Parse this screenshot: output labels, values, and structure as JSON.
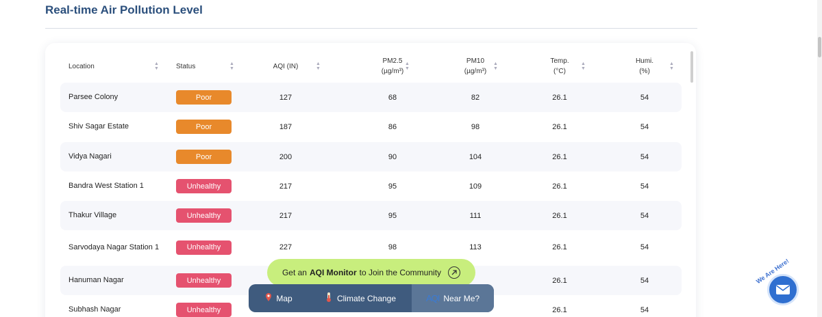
{
  "title": "Real-time Air Pollution Level",
  "table": {
    "headers": [
      {
        "label": "Location",
        "unit": ""
      },
      {
        "label": "Status",
        "unit": ""
      },
      {
        "label": "AQI (IN)",
        "unit": ""
      },
      {
        "label": "PM2.5",
        "unit": "(µg/m³)"
      },
      {
        "label": "PM10",
        "unit": "(µg/m³)"
      },
      {
        "label": "Temp.",
        "unit": "(°C)"
      },
      {
        "label": "Humi.",
        "unit": "(%)"
      }
    ],
    "rows": [
      {
        "location": "Parsee Colony",
        "status": "Poor",
        "aqi": "127",
        "pm25": "68",
        "pm10": "82",
        "temp": "26.1",
        "humi": "54"
      },
      {
        "location": "Shiv Sagar Estate",
        "status": "Poor",
        "aqi": "187",
        "pm25": "86",
        "pm10": "98",
        "temp": "26.1",
        "humi": "54"
      },
      {
        "location": "Vidya Nagari",
        "status": "Poor",
        "aqi": "200",
        "pm25": "90",
        "pm10": "104",
        "temp": "26.1",
        "humi": "54"
      },
      {
        "location": "Bandra West Station 1",
        "status": "Unhealthy",
        "aqi": "217",
        "pm25": "95",
        "pm10": "109",
        "temp": "26.1",
        "humi": "54"
      },
      {
        "location": "Thakur Village",
        "status": "Unhealthy",
        "aqi": "217",
        "pm25": "95",
        "pm10": "111",
        "temp": "26.1",
        "humi": "54"
      },
      {
        "location": "Sarvodaya Nagar Station 1",
        "status": "Unhealthy",
        "aqi": "227",
        "pm25": "98",
        "pm10": "113",
        "temp": "26.1",
        "humi": "54"
      },
      {
        "location": "Hanuman Nagar",
        "status": "Unhealthy",
        "aqi": "",
        "pm25": "",
        "pm10": "",
        "temp": "26.1",
        "humi": "54"
      },
      {
        "location": "Subhash Nagar",
        "status": "Unhealthy",
        "aqi": "",
        "pm25": "",
        "pm10": "",
        "temp": "26.1",
        "humi": "54"
      }
    ]
  },
  "cta": {
    "prefix": "Get an",
    "bold": "AQI Monitor",
    "suffix": "to Join the Community"
  },
  "nav": {
    "map": "Map",
    "climate": "Climate Change",
    "near": "Near Me?",
    "aqi_mark": "AQI"
  },
  "help": {
    "text": "We Are Here!"
  },
  "colors": {
    "poor": "#e8892b",
    "unhealthy": "#e5526f",
    "cta_bg": "#c8ee7d",
    "nav_bg": "#3f5b7e",
    "title": "#2b4f7c"
  }
}
